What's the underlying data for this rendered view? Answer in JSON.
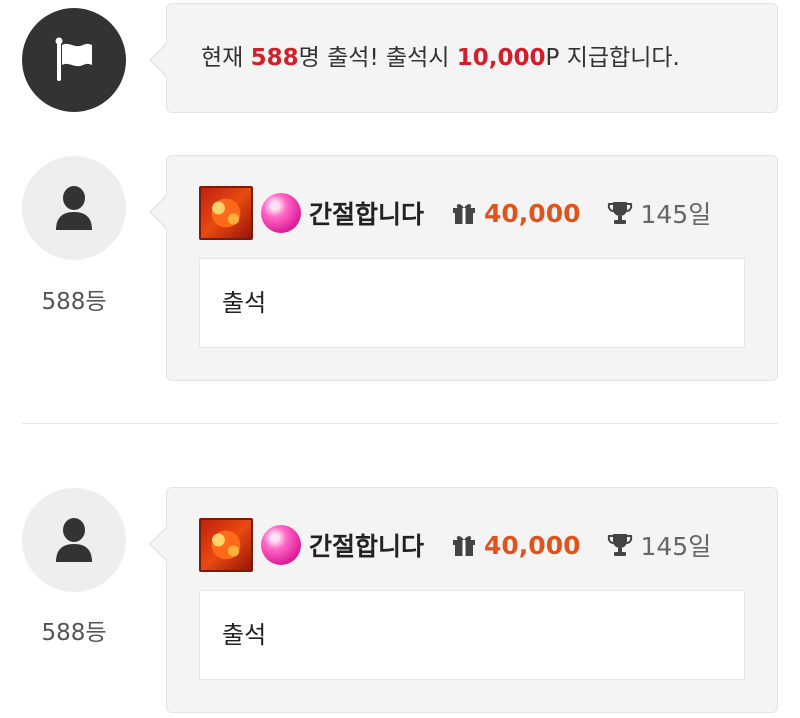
{
  "notice": {
    "prefix": "현재 ",
    "count": "588",
    "mid": "명 출석! 출석시 ",
    "points": "10,000",
    "suffix": "P 지급합니다."
  },
  "entries": [
    {
      "rank": "588등",
      "nickname": "간절합니다",
      "points": "40,000",
      "days": "145일",
      "message": "출석"
    },
    {
      "rank": "588등",
      "nickname": "간절합니다",
      "points": "40,000",
      "days": "145일",
      "message": "출석"
    }
  ],
  "colors": {
    "highlight": "#d0202b",
    "points": "#e0531a",
    "bubble": "#f4f4f4"
  },
  "icons": {
    "notice": "flag-icon",
    "user": "user-icon",
    "gift": "gift-icon",
    "trophy": "trophy-icon"
  }
}
